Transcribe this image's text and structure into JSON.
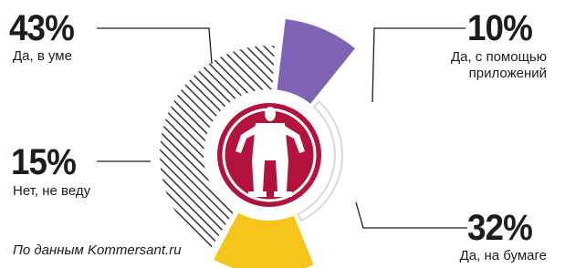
{
  "chart_data": {
    "type": "pie",
    "categories": [
      "Да, в уме",
      "Да, с помощью приложений",
      "Да, на бумаге",
      "Нет, не веду"
    ],
    "values": [
      43,
      10,
      32,
      15
    ],
    "value_labels": [
      "43%",
      "10%",
      "32%",
      "15%"
    ],
    "colors": [
      "#333333",
      "#7f63b4",
      "#d9d9d9",
      "#f6c41a"
    ],
    "fills": [
      "hatched",
      "solid",
      "outline",
      "solid"
    ],
    "center_color": "#b3123d",
    "title": "",
    "legend": "none"
  },
  "source": "По данным Kommersant.ru"
}
